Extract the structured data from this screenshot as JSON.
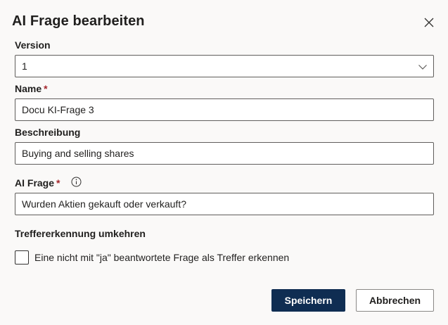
{
  "dialog": {
    "title": "AI Frage bearbeiten",
    "close_icon": "close-icon"
  },
  "version": {
    "label": "Version",
    "value": "1",
    "icon": "chevron-down-icon"
  },
  "name": {
    "label": "Name",
    "required_marker": "*",
    "value": "Docu KI-Frage 3"
  },
  "description": {
    "label": "Beschreibung",
    "value": "Buying and selling shares"
  },
  "ai_question": {
    "label": "AI Frage",
    "required_marker": "*",
    "info_icon": "info-icon",
    "value": "Wurden Aktien gekauft oder verkauft?"
  },
  "invert": {
    "label": "Treffererkennung umkehren",
    "checkbox_label": "Eine nicht mit \"ja\" beantwortete Frage als Treffer erkennen",
    "checked": false
  },
  "buttons": {
    "save": "Speichern",
    "cancel": "Abbrechen"
  },
  "colors": {
    "primary": "#0f2d52",
    "required": "#a4262c",
    "background": "#faf9f8"
  }
}
